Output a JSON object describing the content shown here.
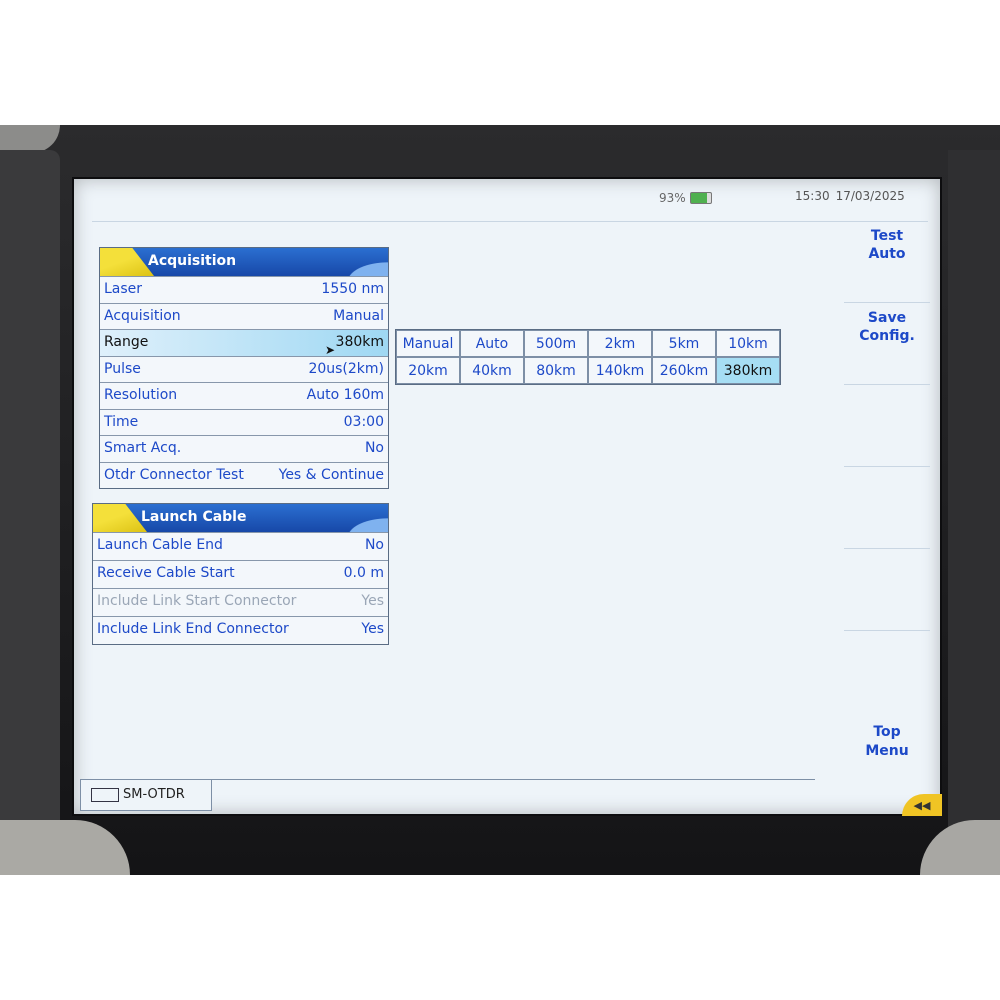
{
  "status": {
    "battery": "93%",
    "time": "15:30",
    "date": "17/03/2025"
  },
  "acquisition": {
    "title": "Acquisition",
    "rows": [
      {
        "label": "Laser",
        "value": "1550 nm"
      },
      {
        "label": "Acquisition",
        "value": "Manual"
      },
      {
        "label": "Range",
        "value": "380km"
      },
      {
        "label": "Pulse",
        "value": "20us(2km)"
      },
      {
        "label": "Resolution",
        "value": "Auto 160m"
      },
      {
        "label": "Time",
        "value": "03:00"
      },
      {
        "label": "Smart Acq.",
        "value": "No"
      },
      {
        "label": "Otdr Connector Test",
        "value": "Yes & Continue"
      }
    ]
  },
  "launch_cable": {
    "title": "Launch Cable",
    "rows": [
      {
        "label": "Launch Cable End",
        "value": "No"
      },
      {
        "label": "Receive Cable Start",
        "value": "0.0 m"
      },
      {
        "label": "Include Link Start Connector",
        "value": "Yes"
      },
      {
        "label": "Include Link End Connector",
        "value": "Yes"
      }
    ]
  },
  "range_options": {
    "row1": [
      "Manual",
      "Auto",
      "500m",
      "2km",
      "5km",
      "10km"
    ],
    "row2": [
      "20km",
      "40km",
      "80km",
      "140km",
      "260km",
      "380km"
    ],
    "selected": "380km"
  },
  "softkeys": {
    "test_line1": "Test",
    "test_line2": "Auto",
    "save_line1": "Save",
    "save_line2": "Config.",
    "top_line1": "Top",
    "top_line2": "Menu"
  },
  "tab": {
    "label": "SM-OTDR"
  },
  "back_label": "◀◀"
}
